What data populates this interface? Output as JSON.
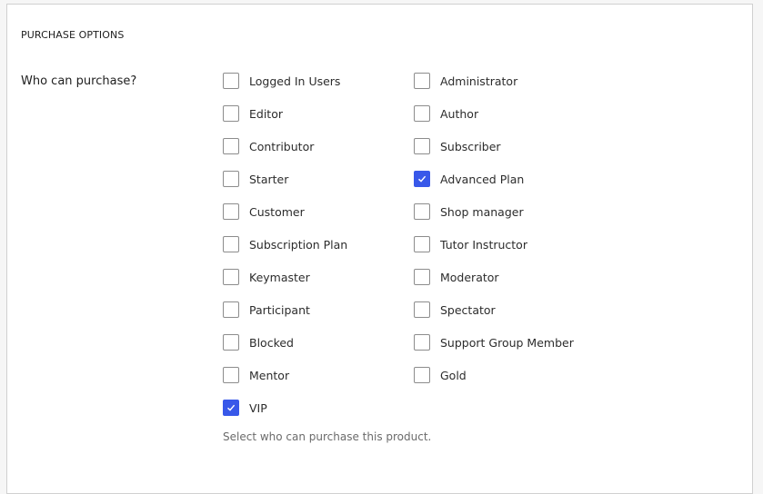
{
  "section": {
    "title": "PURCHASE OPTIONS"
  },
  "field": {
    "label": "Who can purchase?",
    "help": "Select who can purchase this product."
  },
  "accent_color": "#3858e9",
  "options": [
    {
      "label": "Logged In Users",
      "checked": false,
      "col": 0,
      "row": 0
    },
    {
      "label": "Administrator",
      "checked": false,
      "col": 1,
      "row": 0
    },
    {
      "label": "Editor",
      "checked": false,
      "col": 0,
      "row": 1
    },
    {
      "label": "Author",
      "checked": false,
      "col": 1,
      "row": 1
    },
    {
      "label": "Contributor",
      "checked": false,
      "col": 0,
      "row": 2
    },
    {
      "label": "Subscriber",
      "checked": false,
      "col": 1,
      "row": 2
    },
    {
      "label": "Starter",
      "checked": false,
      "col": 0,
      "row": 3
    },
    {
      "label": "Advanced Plan",
      "checked": true,
      "col": 1,
      "row": 3
    },
    {
      "label": "Customer",
      "checked": false,
      "col": 0,
      "row": 4
    },
    {
      "label": "Shop manager",
      "checked": false,
      "col": 1,
      "row": 4
    },
    {
      "label": "Subscription Plan",
      "checked": false,
      "col": 0,
      "row": 5
    },
    {
      "label": "Tutor Instructor",
      "checked": false,
      "col": 1,
      "row": 5
    },
    {
      "label": "Keymaster",
      "checked": false,
      "col": 0,
      "row": 6
    },
    {
      "label": "Moderator",
      "checked": false,
      "col": 1,
      "row": 6
    },
    {
      "label": "Participant",
      "checked": false,
      "col": 0,
      "row": 7
    },
    {
      "label": "Spectator",
      "checked": false,
      "col": 1,
      "row": 7
    },
    {
      "label": "Blocked",
      "checked": false,
      "col": 0,
      "row": 8
    },
    {
      "label": "Support Group Member",
      "checked": false,
      "col": 1,
      "row": 8
    },
    {
      "label": "Mentor",
      "checked": false,
      "col": 0,
      "row": 9
    },
    {
      "label": "Gold",
      "checked": false,
      "col": 1,
      "row": 9
    },
    {
      "label": "VIP",
      "checked": true,
      "col": 0,
      "row": 10
    }
  ]
}
